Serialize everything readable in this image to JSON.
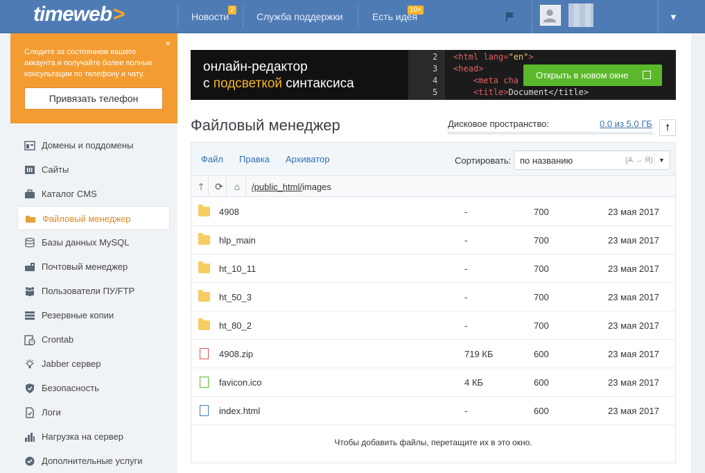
{
  "header": {
    "logo": "timeweb",
    "logo_chevron": ">",
    "nav": [
      {
        "label": "Новости",
        "badge": "2"
      },
      {
        "label": "Служба поддержки"
      },
      {
        "label": "Есть идея",
        "badge": "10+"
      }
    ]
  },
  "promo": {
    "text": "Следите за состоянием вашего аккаунта и получайте более полные консультации по телефону и чату.",
    "close": "×",
    "button": "Привязать телефон"
  },
  "sidebar": {
    "items": [
      {
        "label": "Домены и поддомены",
        "icon": "domains-icon"
      },
      {
        "label": "Сайты",
        "icon": "sites-icon"
      },
      {
        "label": "Каталог CMS",
        "icon": "cms-icon"
      },
      {
        "label": "Файловый менеджер",
        "icon": "folder-icon",
        "active": true
      },
      {
        "label": "Базы данных MySQL",
        "icon": "database-icon"
      },
      {
        "label": "Почтовый менеджер",
        "icon": "mail-icon"
      },
      {
        "label": "Пользователи ПУ/FTP",
        "icon": "users-icon"
      },
      {
        "label": "Резервные копии",
        "icon": "backup-icon"
      },
      {
        "label": "Crontab",
        "icon": "crontab-icon"
      },
      {
        "label": "Jabber сервер",
        "icon": "jabber-icon"
      },
      {
        "label": "Безопасность",
        "icon": "shield-icon"
      },
      {
        "label": "Логи",
        "icon": "logs-icon"
      },
      {
        "label": "Нагрузка на сервер",
        "icon": "chart-icon"
      },
      {
        "label": "Дополнительные услуги",
        "icon": "gear-icon"
      }
    ]
  },
  "banner": {
    "line1": "онлайн-редактор",
    "line2_pre": "с ",
    "line2_hl": "подсветкой",
    "line2_post": " синтаксиса",
    "code_lines": [
      {
        "n": "2",
        "pre": "<html lang=",
        "str": "\"en\"",
        "post": ">"
      },
      {
        "n": "3",
        "pre": "<head>",
        "str": "",
        "post": ""
      },
      {
        "n": "4",
        "pre": "    <meta cha",
        "str": "",
        "post": ""
      },
      {
        "n": "5",
        "pre": "    <title>",
        "str": "",
        "post": "Document</title>"
      }
    ],
    "button": "Открыть в новом окне"
  },
  "page": {
    "title": "Файловый менеджер",
    "disk_label": "Дисковое пространство:",
    "disk_value": "0.0 из 5.0 ГБ",
    "disk_used_fraction": 0.0
  },
  "fm": {
    "tabs": [
      "Файл",
      "Правка",
      "Архиватор"
    ],
    "sort_label": "Сортировать:",
    "sort_value": "по названию",
    "sort_hint": "(А → Я)",
    "path_root": "/public_html/",
    "path_current": "images",
    "files": [
      {
        "name": "4908",
        "type": "folder",
        "size": "-",
        "perm": "700",
        "date": "23 мая 2017"
      },
      {
        "name": "hlp_main",
        "type": "folder",
        "size": "-",
        "perm": "700",
        "date": "23 мая 2017"
      },
      {
        "name": "ht_10_11",
        "type": "folder",
        "size": "-",
        "perm": "700",
        "date": "23 мая 2017"
      },
      {
        "name": "ht_50_3",
        "type": "folder",
        "size": "-",
        "perm": "700",
        "date": "23 мая 2017"
      },
      {
        "name": "ht_80_2",
        "type": "folder",
        "size": "-",
        "perm": "700",
        "date": "23 мая 2017"
      },
      {
        "name": "4908.zip",
        "type": "zip",
        "size": "719 КБ",
        "perm": "600",
        "date": "23 мая 2017"
      },
      {
        "name": "favicon.ico",
        "type": "image",
        "size": "4 КБ",
        "perm": "600",
        "date": "23 мая 2017"
      },
      {
        "name": "index.html",
        "type": "html",
        "size": "-",
        "perm": "600",
        "date": "23 мая 2017"
      }
    ],
    "drop_hint": "Чтобы добавить файлы, перетащите их в это окно."
  },
  "colors": {
    "header": "#4f7bb5",
    "accent": "#f39c32",
    "green": "#5bb82b",
    "link": "#2f6fb6"
  }
}
